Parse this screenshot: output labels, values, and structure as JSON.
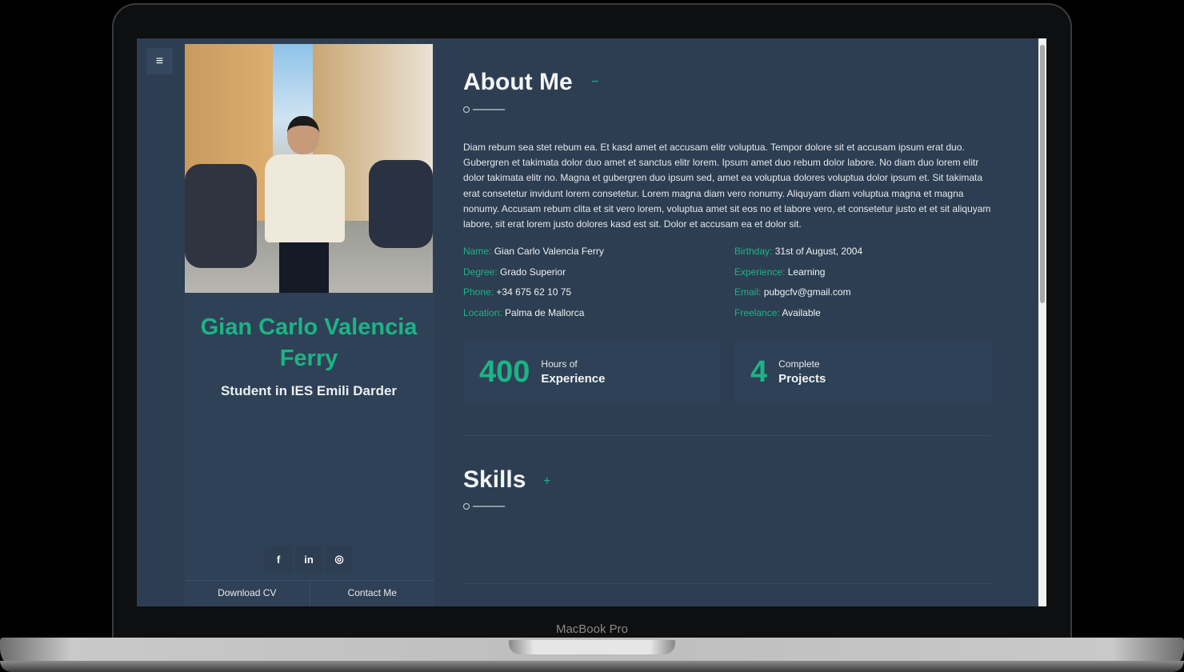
{
  "device": {
    "label": "MacBook Pro"
  },
  "nav": {
    "menu_icon": "hamburger-icon",
    "menu_glyph": "≡"
  },
  "profile": {
    "name": "Gian Carlo Valencia Ferry",
    "role": "Student in IES Emili Darder",
    "social": [
      {
        "icon": "facebook-icon",
        "glyph": "f"
      },
      {
        "icon": "linkedin-icon",
        "glyph": "in"
      },
      {
        "icon": "instagram-icon",
        "glyph": "◎"
      }
    ],
    "download_label": "Download CV",
    "contact_label": "Contact Me"
  },
  "about": {
    "title": "About Me",
    "toggle": "−",
    "bio": "Diam rebum sea stet rebum ea. Et kasd amet et accusam elitr voluptua. Tempor dolore sit et accusam ipsum erat duo. Gubergren et takimata dolor duo amet et sanctus elitr lorem. Ipsum amet duo rebum dolor labore. No diam duo lorem elitr dolor takimata elitr no. Magna et gubergren duo ipsum sed, amet ea voluptua dolores voluptua dolor ipsum et. Sit takimata erat consetetur invidunt lorem consetetur. Lorem magna diam vero nonumy. Aliquyam diam voluptua magna et magna nonumy. Accusam rebum clita et sit vero lorem, voluptua amet sit eos no et labore vero, et consetetur justo et et sit aliquyam labore, sit erat lorem justo dolores kasd est sit. Dolor et accusam ea et dolor sit.",
    "info": [
      {
        "key": "Name:",
        "value": "Gian Carlo Valencia Ferry"
      },
      {
        "key": "Birthday:",
        "value": "31st of August, 2004"
      },
      {
        "key": "Degree:",
        "value": "Grado Superior"
      },
      {
        "key": "Experience:",
        "value": "Learning"
      },
      {
        "key": "Phone:",
        "value": "+34 675 62 10 75"
      },
      {
        "key": "Email:",
        "value": "pubgcfv@gmail.com"
      },
      {
        "key": "Location:",
        "value": "Palma de Mallorca"
      },
      {
        "key": "Freelance:",
        "value": "Available"
      }
    ],
    "stats": [
      {
        "number": "400",
        "line1": "Hours of",
        "line2": "Experience"
      },
      {
        "number": "4",
        "line1": "Complete",
        "line2": "Projects"
      }
    ]
  },
  "skills": {
    "title": "Skills",
    "toggle": "+"
  },
  "colors": {
    "accent": "#1db386",
    "background": "#2d3e52"
  }
}
